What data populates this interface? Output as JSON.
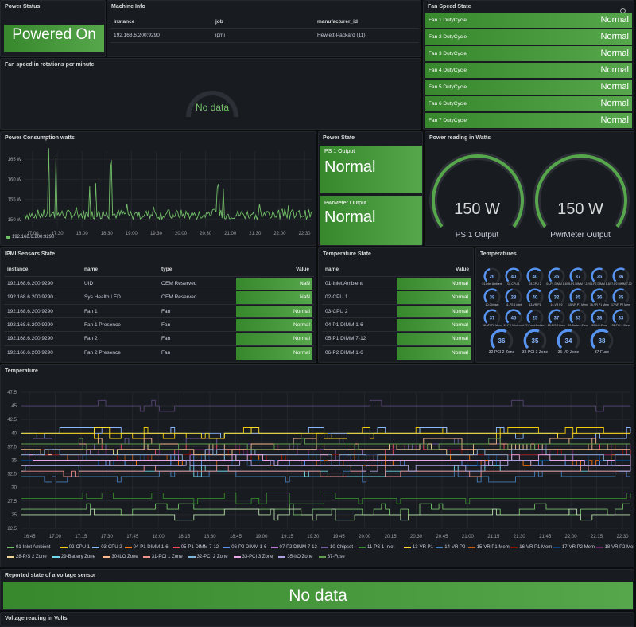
{
  "power_status": {
    "title": "Power Status",
    "value": "Powered On"
  },
  "machine_info": {
    "title": "Machine Info",
    "headers": [
      "instance",
      "job",
      "manufacturer_id"
    ],
    "row": [
      "192.168.6.200:9290",
      "ipmi",
      "Hewlett-Packard (11)"
    ]
  },
  "fan_speed_state": {
    "title": "Fan Speed State",
    "rows": [
      {
        "label": "Fan 1 DutyCycle",
        "value": "Normal"
      },
      {
        "label": "Fan 2 DutyCycle",
        "value": "Normal"
      },
      {
        "label": "Fan 3 DutyCycle",
        "value": "Normal"
      },
      {
        "label": "Fan 4 DutyCycle",
        "value": "Normal"
      },
      {
        "label": "Fan 5 DutyCycle",
        "value": "Normal"
      },
      {
        "label": "Fan 6 DutyCycle",
        "value": "Normal"
      },
      {
        "label": "Fan 7 DutyCycle",
        "value": "Normal"
      }
    ]
  },
  "fan_rpm": {
    "title": "Fan speed in rotations per minute",
    "value": "No data"
  },
  "power_consumption": {
    "title": "Power Consumption watts",
    "legend": "192.168.6.200:9290"
  },
  "power_state": {
    "title": "Power State",
    "items": [
      {
        "label": "PS 1 Output",
        "value": "Normal"
      },
      {
        "label": "PwrMeter Output",
        "value": "Normal"
      }
    ]
  },
  "power_reading": {
    "title": "Power reading in Watts",
    "gauges": [
      {
        "label": "PS 1 Output",
        "value": "150 W",
        "level": 0.5
      },
      {
        "label": "PwrMeter Output",
        "value": "150 W",
        "level": 0.5
      }
    ]
  },
  "ipmi_sensors": {
    "title": "IPMI Sensors State",
    "headers": [
      "instance",
      "name",
      "type",
      "Value"
    ],
    "rows": [
      [
        "192.168.6.200:9290",
        "UID",
        "OEM Reserved",
        "NaN"
      ],
      [
        "192.168.6.200:9290",
        "Sys Health LED",
        "OEM Reserved",
        "NaN"
      ],
      [
        "192.168.6.200:9290",
        "Fan 1",
        "Fan",
        "Normal"
      ],
      [
        "192.168.6.200:9290",
        "Fan 1 Presence",
        "Fan",
        "Normal"
      ],
      [
        "192.168.6.200:9290",
        "Fan 2",
        "Fan",
        "Normal"
      ],
      [
        "192.168.6.200:9290",
        "Fan 2 Presence",
        "Fan",
        "Normal"
      ]
    ]
  },
  "temperature_state": {
    "title": "Temperature State",
    "headers": [
      "name",
      "Value"
    ],
    "rows": [
      [
        "01-Inlet Ambient",
        "Normal"
      ],
      [
        "02-CPU 1",
        "Normal"
      ],
      [
        "03-CPU 2",
        "Normal"
      ],
      [
        "04-P1 DIMM 1-6",
        "Normal"
      ],
      [
        "05-P1 DIMM 7-12",
        "Normal"
      ],
      [
        "06-P2 DIMM 1-6",
        "Normal"
      ]
    ]
  },
  "temperatures": {
    "title": "Temperatures",
    "small": [
      [
        "26",
        "01-Inlet Ambient"
      ],
      [
        "40",
        "02-CPU 1"
      ],
      [
        "40",
        "03-CPU 2"
      ],
      [
        "35",
        "04-P1 DIMM 1-6"
      ],
      [
        "37",
        "05-P1 DIMM 7-12"
      ],
      [
        "35",
        "06-P2 DIMM 1-6"
      ],
      [
        "36",
        "07-P2 DIMM 7-12"
      ],
      [
        "38",
        "10-Chipset"
      ],
      [
        "28",
        "11-PS 1 Inlet"
      ],
      [
        "40",
        "13-VR P1"
      ],
      [
        "32",
        "14-VR P2"
      ],
      [
        "35",
        "15-VR P1 Mem"
      ],
      [
        "36",
        "16-VR P1 Mem"
      ],
      [
        "35",
        "17-VR P2 Mem"
      ],
      [
        "37",
        "18-VR P2 Mem"
      ],
      [
        "45",
        "19-PS 1 Internal"
      ],
      [
        "25",
        "27-Front Ambient"
      ],
      [
        "37",
        "28-P/S 2 Zone"
      ],
      [
        "33",
        "29-Battery Zone"
      ],
      [
        "38",
        "30-iLO Zone"
      ],
      [
        "33",
        "31-PCI 1 Zone"
      ]
    ],
    "large": [
      [
        "36",
        "32-PCI 2 Zone"
      ],
      [
        "35",
        "33-PCI 3 Zone"
      ],
      [
        "34",
        "35-I/O Zone"
      ],
      [
        "38",
        "37-Fuse"
      ]
    ]
  },
  "temperature_chart": {
    "title": "Temperature"
  },
  "voltage_state": {
    "title": "Reported state of a voltage sensor",
    "value": "No data"
  },
  "voltage_reading": {
    "title": "Voltage reading in Volts"
  },
  "colors": {
    "accent": "#56a64b",
    "panel": "#181b1f",
    "bg": "#0b0c0e"
  },
  "chart_data": [
    {
      "type": "line",
      "title": "Power Consumption watts",
      "x": [
        "17:00",
        "17:30",
        "18:00",
        "18:30",
        "19:00",
        "19:30",
        "20:00",
        "20:30",
        "21:00",
        "21:30",
        "22:00",
        "22:30"
      ],
      "ylim": [
        148,
        167
      ],
      "yticks": [
        "165 W",
        "160 W",
        "155 W",
        "150 W"
      ],
      "series": [
        {
          "name": "192.168.6.200:9290",
          "values": [
            150,
            151,
            165,
            149,
            152,
            158,
            150,
            163,
            151,
            149,
            153,
            151,
            150,
            160,
            149,
            150,
            157,
            152,
            150,
            151,
            149,
            152,
            150,
            151
          ]
        }
      ]
    },
    {
      "type": "line",
      "title": "Temperature",
      "ylim": [
        22.5,
        47.5
      ],
      "yticks": [
        "47.5",
        "45",
        "42.5",
        "40",
        "37.5",
        "35",
        "32.5",
        "30",
        "27.5",
        "25",
        "22.5"
      ],
      "x": [
        "16:45",
        "17:00",
        "17:15",
        "17:30",
        "17:45",
        "18:00",
        "18:15",
        "18:30",
        "18:45",
        "19:00",
        "19:15",
        "19:30",
        "19:45",
        "20:00",
        "20:15",
        "20:30",
        "20:45",
        "21:00",
        "21:15",
        "21:30",
        "21:45",
        "22:00",
        "22:15",
        "22:30"
      ],
      "series": [
        {
          "name": "01-Inlet Ambient",
          "color": "#73bf69",
          "value": 26
        },
        {
          "name": "02-CPU 1",
          "color": "#f2cc0c",
          "value": 40
        },
        {
          "name": "03-CPU 2",
          "color": "#8ab8ff",
          "value": 40
        },
        {
          "name": "04-P1 DIMM 1-6",
          "color": "#ff780a",
          "value": 35
        },
        {
          "name": "05-P1 DIMM 7-12",
          "color": "#f2495c",
          "value": 37
        },
        {
          "name": "06-P2 DIMM 1-6",
          "color": "#5794f2",
          "value": 35
        },
        {
          "name": "07-P2 DIMM 7-12",
          "color": "#b877d9",
          "value": 36
        },
        {
          "name": "10-Chipset",
          "color": "#705da0",
          "value": 38
        },
        {
          "name": "11-PS 1 Inlet",
          "color": "#37872d",
          "value": 28
        },
        {
          "name": "13-VR P1",
          "color": "#fade2a",
          "value": 40
        },
        {
          "name": "14-VR P2",
          "color": "#447ebc",
          "value": 32
        },
        {
          "name": "15-VR P1 Mem",
          "color": "#c15c17",
          "value": 35
        },
        {
          "name": "16-VR P1 Mem",
          "color": "#890f02",
          "value": 36
        },
        {
          "name": "17-VR P2 Mem",
          "color": "#0a437c",
          "value": 35
        },
        {
          "name": "18-VR P2 Mem",
          "color": "#6d1f62",
          "value": 37
        },
        {
          "name": "19-PS 1 Internal",
          "color": "#584477",
          "value": 45
        },
        {
          "name": "27-Front Ambient",
          "color": "#b7dbab",
          "value": 25
        },
        {
          "name": "28-P/S 2 Zone",
          "color": "#f4d598",
          "value": 37
        },
        {
          "name": "29-Battery Zone",
          "color": "#70dbed",
          "value": 33
        },
        {
          "name": "30-iLO Zone",
          "color": "#f9ba8f",
          "value": 38
        },
        {
          "name": "31-PCI 1 Zone",
          "color": "#f29191",
          "value": 33
        },
        {
          "name": "32-PCI 2 Zone",
          "color": "#82b5d8",
          "value": 36
        },
        {
          "name": "33-PCI 3 Zone",
          "color": "#e5a8e2",
          "value": 35
        },
        {
          "name": "35-I/O Zone",
          "color": "#aea2e0",
          "value": 34
        },
        {
          "name": "37-Fuse",
          "color": "#629e51",
          "value": 38
        }
      ]
    }
  ]
}
